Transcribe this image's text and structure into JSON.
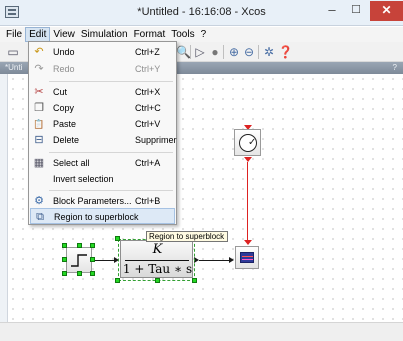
{
  "window": {
    "title": "*Untitled - 16:16:08 - Xcos",
    "minimize_glyph": "–",
    "maximize_glyph": "☐",
    "close_glyph": "✕"
  },
  "menubar": {
    "items": [
      {
        "label": "File"
      },
      {
        "label": "Edit"
      },
      {
        "label": "View"
      },
      {
        "label": "Simulation"
      },
      {
        "label": "Format"
      },
      {
        "label": "Tools"
      },
      {
        "label": "?"
      }
    ]
  },
  "tab": {
    "label": "*Unti",
    "help": "?"
  },
  "edit_menu": {
    "items": [
      {
        "label": "Undo",
        "shortcut": "Ctrl+Z",
        "icon": "undo-icon",
        "glyph": "↶"
      },
      {
        "label": "Redo",
        "shortcut": "Ctrl+Y",
        "icon": "redo-icon",
        "glyph": "↷"
      },
      {
        "label": "Cut",
        "shortcut": "Ctrl+X",
        "icon": "scissors-icon",
        "glyph": "✂"
      },
      {
        "label": "Copy",
        "shortcut": "Ctrl+C",
        "icon": "copy-icon",
        "glyph": "❐"
      },
      {
        "label": "Paste",
        "shortcut": "Ctrl+V",
        "icon": "paste-icon",
        "glyph": "📋"
      },
      {
        "label": "Delete",
        "shortcut": "Supprimer",
        "icon": "delete-icon",
        "glyph": "⊟"
      },
      {
        "label": "Select all",
        "shortcut": "Ctrl+A",
        "icon": "select-all-icon",
        "glyph": "▦"
      },
      {
        "label": "Invert selection",
        "shortcut": "",
        "icon": "",
        "glyph": ""
      },
      {
        "label": "Block Parameters...",
        "shortcut": "Ctrl+B",
        "icon": "gear-icon",
        "glyph": "⚙"
      },
      {
        "label": "Region to superblock",
        "shortcut": "",
        "icon": "superblock-icon",
        "glyph": "⧉"
      }
    ]
  },
  "tooltip": {
    "text": "Region to superblock"
  },
  "blocks": {
    "transfer_function": {
      "numerator": "K",
      "denominator": "1 + Tau ∗ s"
    },
    "clock_glyph": "✓"
  },
  "toolbar": {
    "icons": [
      "new-diagram-icon",
      "zoom-icon",
      "start-icon",
      "stop-icon",
      "zoom-in-icon",
      "zoom-out-icon",
      "palette-icon",
      "help-icon"
    ]
  }
}
